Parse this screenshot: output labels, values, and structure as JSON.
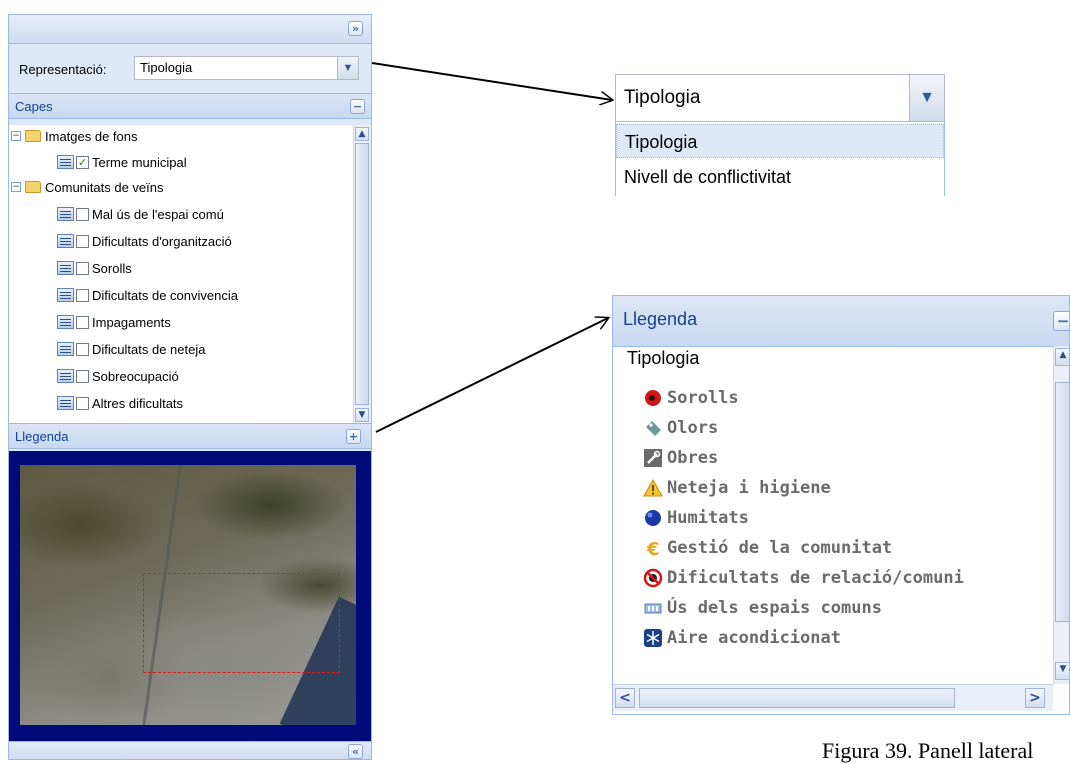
{
  "left_panel": {
    "collapse_label": "»",
    "expand_bottom_label": "«",
    "representacio": {
      "label": "Representació:",
      "value": "Tipologia"
    },
    "capes": {
      "title": "Capes",
      "toggle": "−",
      "groups": [
        {
          "label": "Imatges de fons",
          "items": [
            {
              "label": "Terme municipal",
              "checked": true
            }
          ]
        },
        {
          "label": "Comunitats de veïns",
          "items": [
            {
              "label": "Mal ús de l'espai comú",
              "checked": false
            },
            {
              "label": "Dificultats d'organització",
              "checked": false
            },
            {
              "label": "Sorolls",
              "checked": false
            },
            {
              "label": "Dificultats de convivencia",
              "checked": false
            },
            {
              "label": "Impagaments",
              "checked": false
            },
            {
              "label": "Dificultats de neteja",
              "checked": false
            },
            {
              "label": "Sobreocupació",
              "checked": false
            },
            {
              "label": "Altres dificultats",
              "checked": false
            }
          ]
        }
      ]
    },
    "llegenda": {
      "title": "Llegenda",
      "toggle": "+"
    }
  },
  "zoom_dropdown": {
    "value": "Tipologia",
    "options": [
      "Tipologia",
      "Nivell de conflictivitat"
    ],
    "selected_index": 0
  },
  "zoom_legend": {
    "title": "Llegenda",
    "toggle": "−",
    "subtitle": "Tipologia",
    "items": [
      {
        "label": "Sorolls",
        "icon": "speaker-icon"
      },
      {
        "label": "Olors",
        "icon": "tag-icon"
      },
      {
        "label": "Obres",
        "icon": "wrench-icon"
      },
      {
        "label": "Neteja i higiene",
        "icon": "warning-icon"
      },
      {
        "label": "Humitats",
        "icon": "sphere-icon"
      },
      {
        "label": "Gestió de la comunitat",
        "icon": "euro-icon"
      },
      {
        "label": "Dificultats de relació/comuni",
        "icon": "no-entry-icon"
      },
      {
        "label": "Ús dels espais comuns",
        "icon": "door-icon"
      },
      {
        "label": "Aire acondicionat",
        "icon": "snowflake-icon"
      }
    ]
  },
  "caption": "Figura 39. Panell lateral",
  "colors": {
    "panel_border": "#99bbe8",
    "header_text": "#15428b",
    "map_background": "#000a78",
    "map_box": "#e31b1b"
  }
}
